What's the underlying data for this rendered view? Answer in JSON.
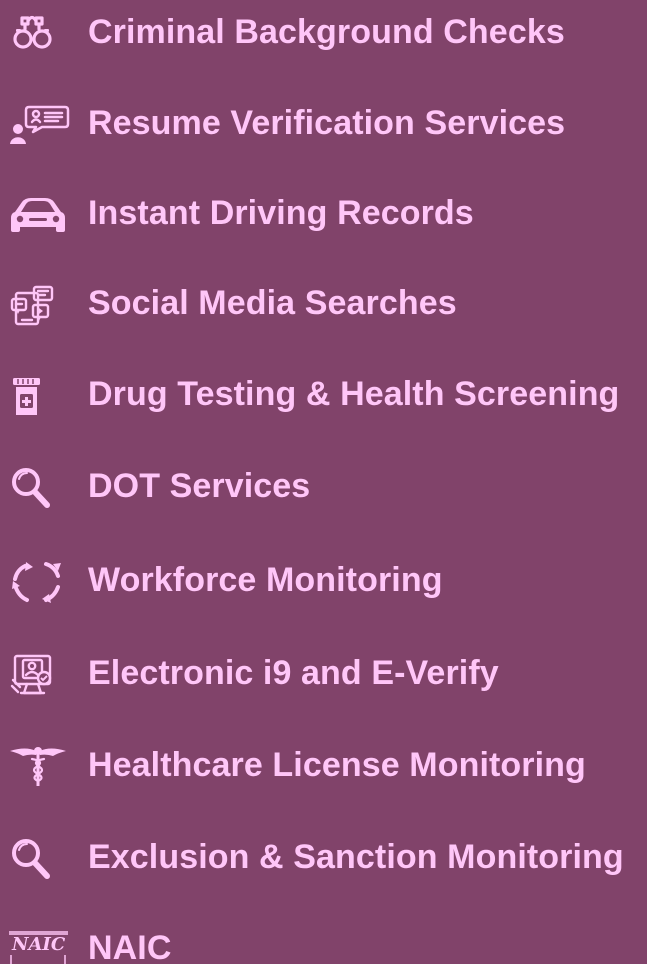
{
  "colors": {
    "background": "#81436a",
    "text": "#ffc6f8",
    "icon": "#ffc6f8"
  },
  "services": [
    {
      "label": "Criminal Background Checks",
      "icon": "handcuffs-icon"
    },
    {
      "label": "Resume Verification Services",
      "icon": "resume-speech-icon"
    },
    {
      "label": "Instant Driving Records",
      "icon": "car-icon"
    },
    {
      "label": "Social Media Searches",
      "icon": "social-media-icon"
    },
    {
      "label": "Drug Testing & Health Screening",
      "icon": "medicine-bottle-icon"
    },
    {
      "label": "DOT Services",
      "icon": "magnifying-glass-icon"
    },
    {
      "label": "Workforce Monitoring",
      "icon": "refresh-cycle-icon"
    },
    {
      "label": "Electronic i9 and E-Verify",
      "icon": "document-computer-icon"
    },
    {
      "label": "Healthcare License Monitoring",
      "icon": "caduceus-icon"
    },
    {
      "label": "Exclusion & Sanction Monitoring",
      "icon": "magnifying-glass-icon"
    },
    {
      "label": "NAIC",
      "icon": "naic-logo-icon"
    }
  ],
  "logos": {
    "naic": "NAIC"
  }
}
